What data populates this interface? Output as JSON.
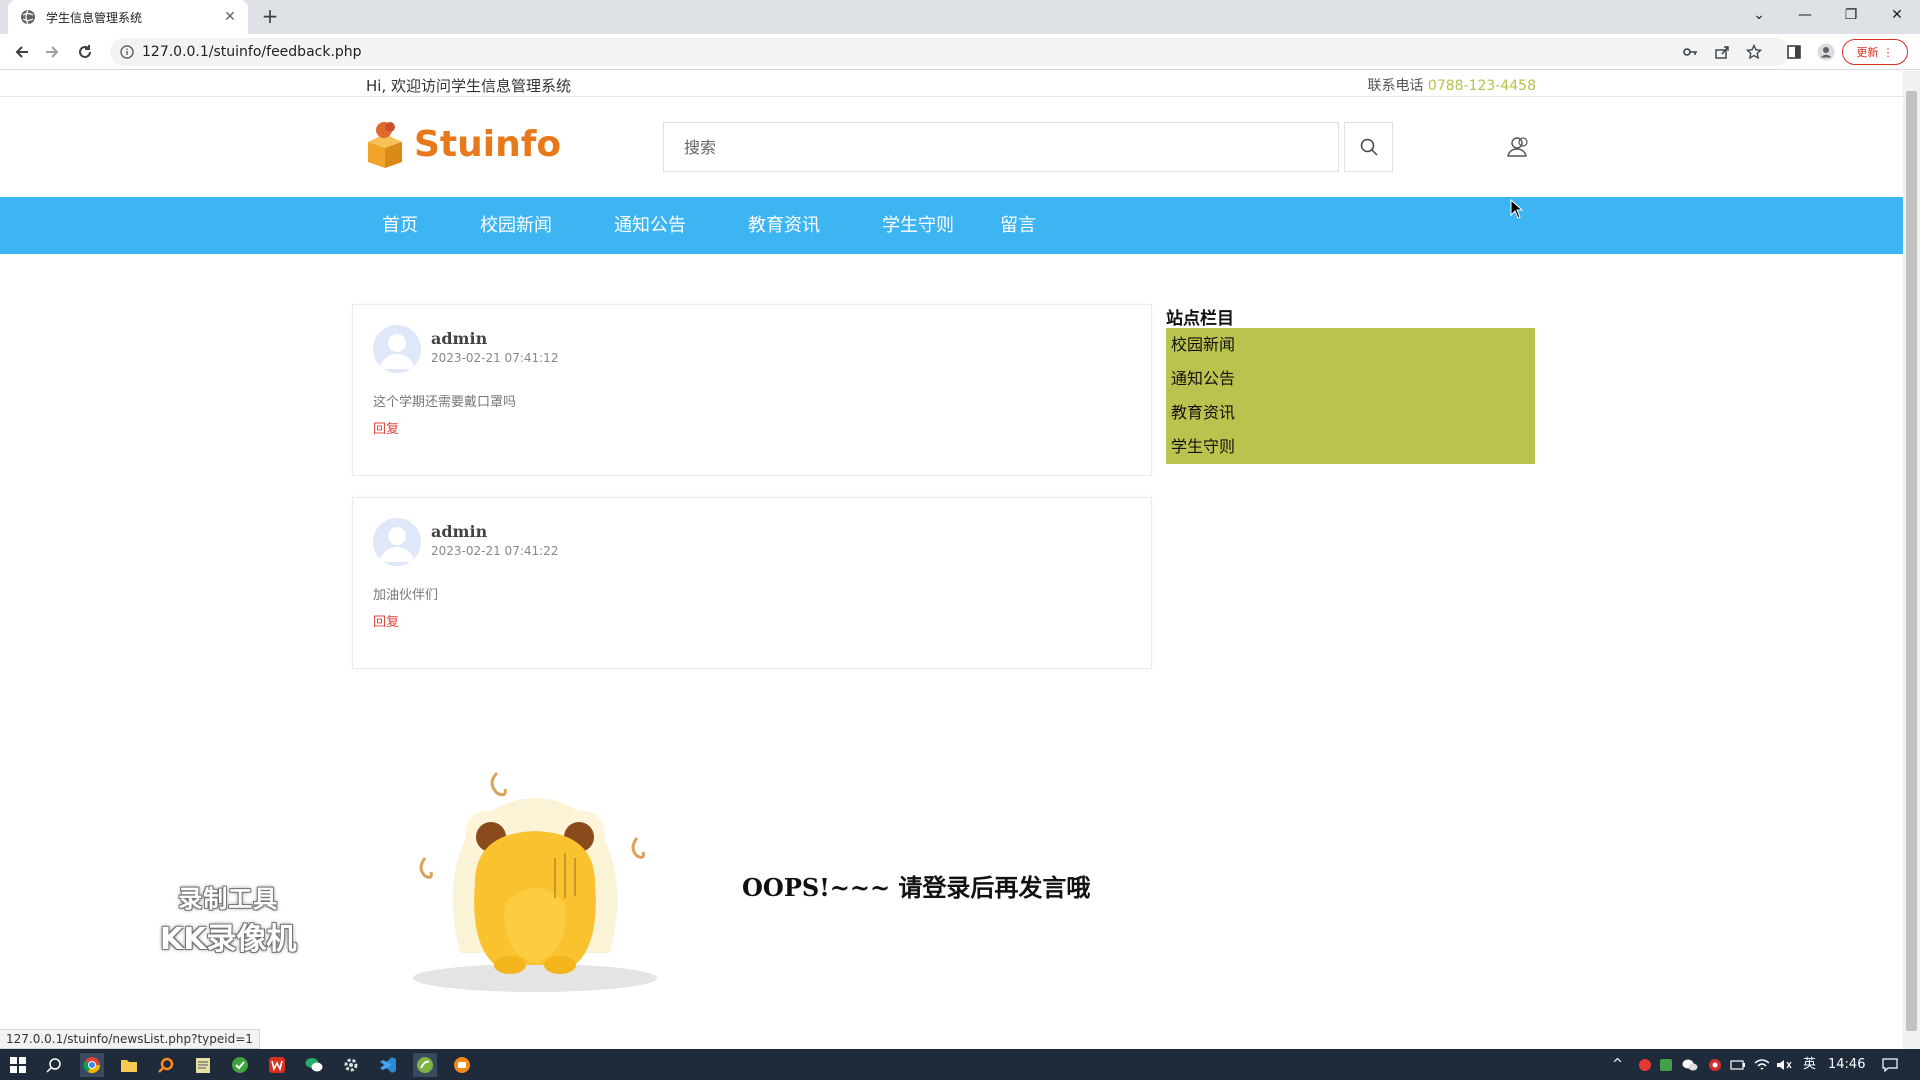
{
  "browser": {
    "tab_title": "学生信息管理系统",
    "url": "127.0.0.1/stuinfo/feedback.php",
    "update_label": "更新",
    "status_url": "127.0.0.1/stuinfo/newsList.php?typeid=1"
  },
  "site": {
    "welcome": "Hi, 欢迎访问学生信息管理系统",
    "contact_label": "联系电话",
    "phone": "0788-123-4458",
    "logo_text": "Stuinfo",
    "search_placeholder": "搜索"
  },
  "nav": {
    "items": [
      "首页",
      "校园新闻",
      "通知公告",
      "教育资讯",
      "学生守则",
      "留言"
    ]
  },
  "comments": [
    {
      "user": "admin",
      "time": "2023-02-21 07:41:12",
      "text": "这个学期还需要戴口罩吗",
      "reply": "回复"
    },
    {
      "user": "admin",
      "time": "2023-02-21 07:41:22",
      "text": "加油伙伴们",
      "reply": "回复"
    }
  ],
  "sidebar": {
    "title": "站点栏目",
    "items": [
      "校园新闻",
      "通知公告",
      "教育资讯",
      "学生守则"
    ]
  },
  "oops": {
    "text": "OOPS!~~~ 请登录后再发言哦"
  },
  "watermark": {
    "line1": "录制工具",
    "line2": "KK录像机"
  },
  "taskbar": {
    "ime": "英",
    "time": "14:46"
  },
  "colors": {
    "nav_bg": "#3db5f2",
    "sidebar_bg": "#bbc34f",
    "logo": "#e8791b",
    "phone": "#b8c14c",
    "reply": "#e0453a"
  }
}
